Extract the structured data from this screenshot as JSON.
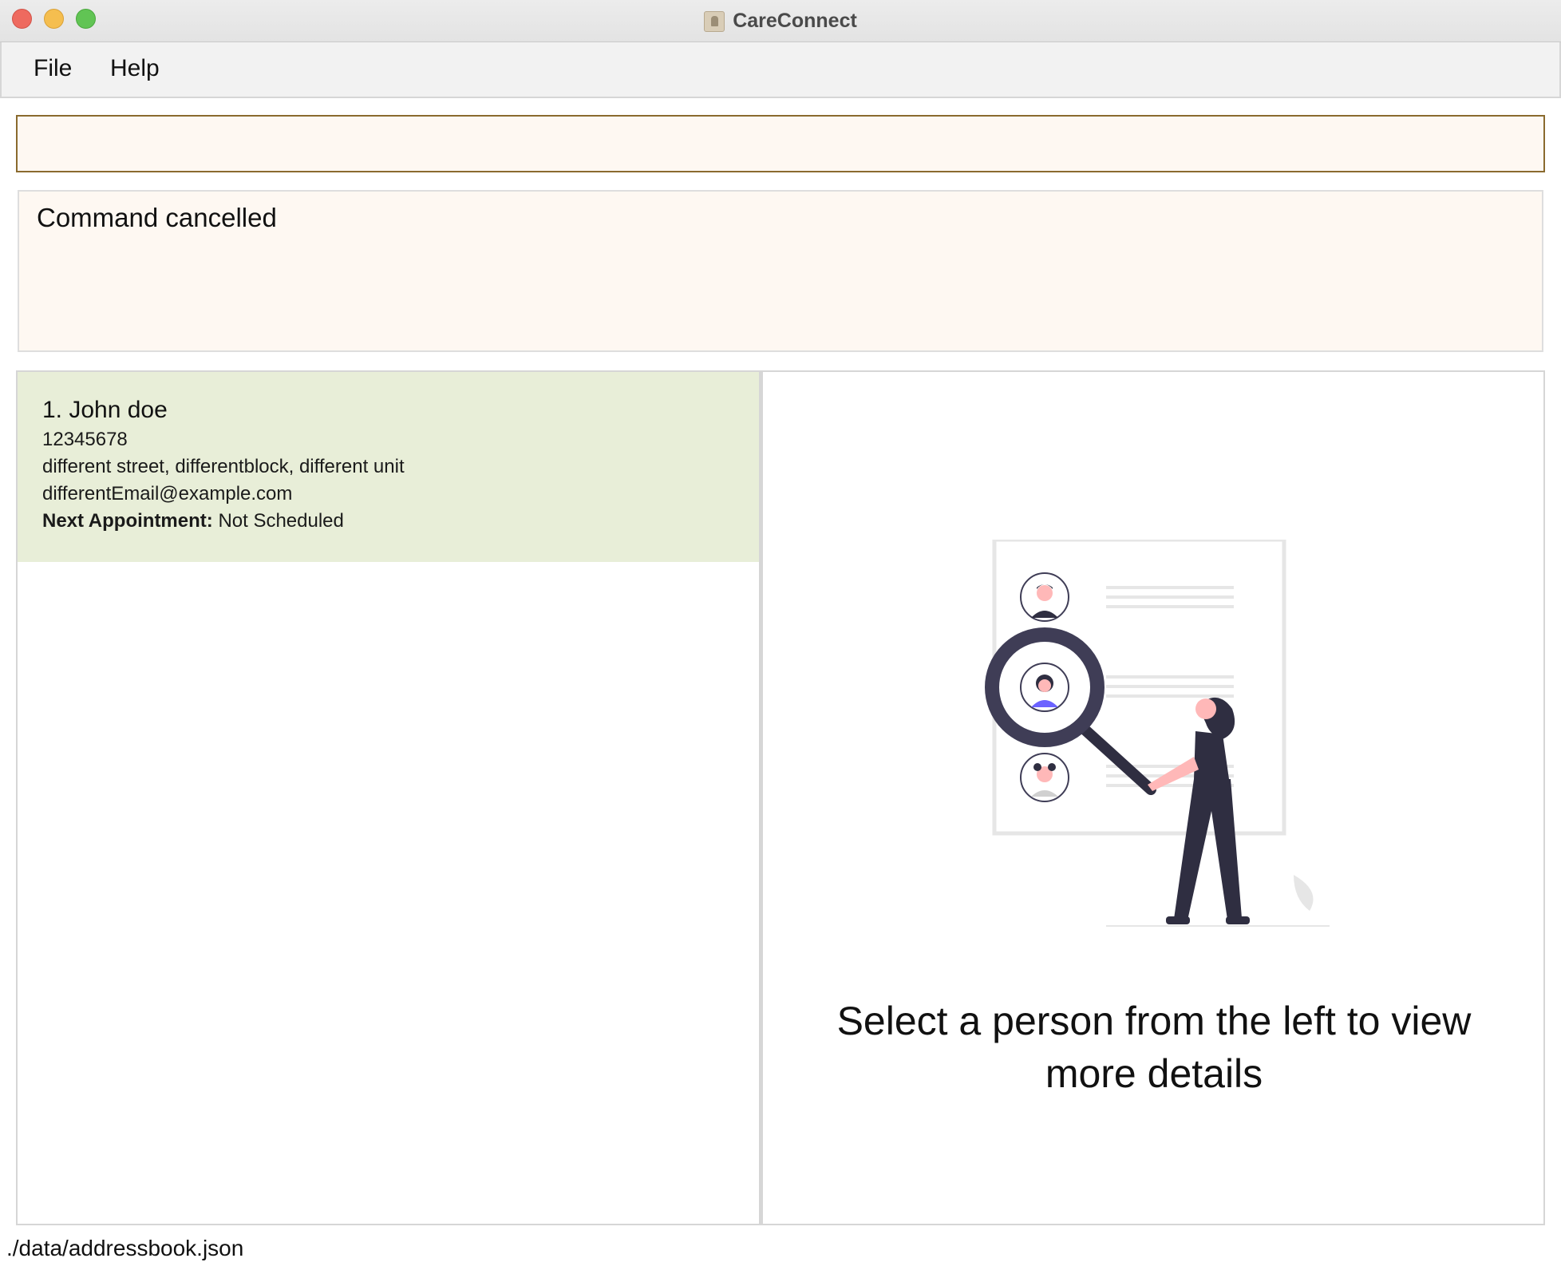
{
  "window": {
    "title": "CareConnect",
    "app_icon": "address-book-icon"
  },
  "menu": {
    "items": [
      {
        "label": "File"
      },
      {
        "label": "Help"
      }
    ]
  },
  "command_box": {
    "value": "",
    "placeholder": ""
  },
  "result": {
    "message": "Command cancelled"
  },
  "person_list": {
    "persons": [
      {
        "name": "1. John doe",
        "phone": "12345678",
        "address": "different street, differentblock, different unit",
        "email": "differentEmail@example.com",
        "appointment_label": "Next Appointment:",
        "appointment_value": "Not Scheduled"
      }
    ]
  },
  "detail": {
    "prompt": "Select a person from the left to view more details",
    "illustration": "person-search-illustration"
  },
  "status_bar": {
    "file_path": "./data/addressbook.json"
  },
  "colors": {
    "card_selected_bg": "#e8eed8",
    "command_bg": "#fef8f2",
    "command_border": "#8a6a2e",
    "illustration_dark": "#2f2e41",
    "illustration_accent": "#6c63ff",
    "illustration_skin": "#ffb8b8"
  }
}
